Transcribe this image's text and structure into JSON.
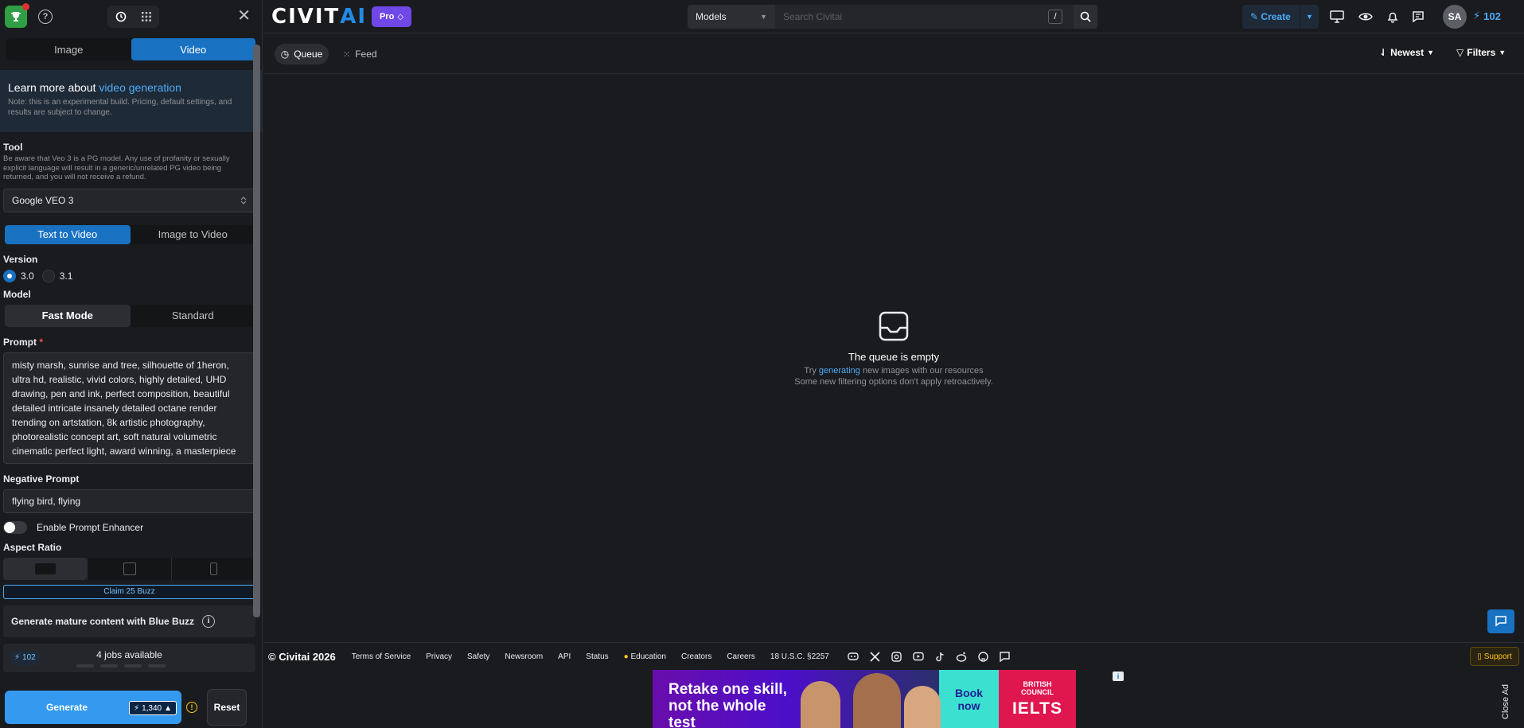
{
  "left_panel": {
    "tabs": [
      "Image",
      "Video"
    ],
    "learn_more": {
      "prefix": "Learn more about ",
      "link": "video generation",
      "note": "Note: this is an experimental build. Pricing, default settings, and results are subject to change."
    },
    "tool": {
      "label": "Tool",
      "warning": "Be aware that Veo 3 is a PG model. Any use of profanity or sexually explicit language will result in a generic/unrelated PG video being returned, and you will not receive a refund.",
      "selected": "Google VEO 3"
    },
    "mode_tabs": [
      "Text to Video",
      "Image to Video"
    ],
    "version": {
      "label": "Version",
      "options": [
        "3.0",
        "3.1"
      ],
      "selected": "3.0"
    },
    "model": {
      "label": "Model",
      "options": [
        "Fast Mode",
        "Standard"
      ],
      "selected": "Fast Mode"
    },
    "prompt": {
      "label": "Prompt",
      "required_mark": "*",
      "value": "misty marsh, sunrise and tree, silhouette of 1heron, ultra hd, realistic, vivid colors, highly detailed, UHD drawing, pen and ink, perfect composition, beautiful detailed intricate insanely detailed octane render trending on artstation, 8k artistic photography, photorealistic concept art, soft natural volumetric cinematic perfect light, award winning, a masterpiece"
    },
    "negative_prompt": {
      "label": "Negative Prompt",
      "value": "flying bird, flying"
    },
    "prompt_enhancer": {
      "label": "Enable Prompt Enhancer",
      "enabled": false
    },
    "aspect_ratio": {
      "label": "Aspect Ratio",
      "selected_index": 0
    },
    "claim_label": "Claim 25 Buzz",
    "mature_label": "Generate mature content with Blue Buzz",
    "jobs": {
      "buzz": "102",
      "text": "4 jobs available"
    },
    "generate_label": "Generate",
    "generate_cost": "1,340",
    "reset_label": "Reset"
  },
  "header": {
    "logo_a": "CIVIT",
    "logo_b": "AI",
    "pro_label": "Pro",
    "search_category": "Models",
    "search_placeholder": "Search Civitai",
    "search_shortcut": "/",
    "create_label": "Create",
    "avatar_initials": "SA",
    "buzz": "102"
  },
  "subbar": {
    "queue_label": "Queue",
    "feed_label": "Feed",
    "sort_label": "Newest",
    "filters_label": "Filters"
  },
  "empty_state": {
    "title": "The queue is empty",
    "line1_pre": "Try ",
    "line1_link": "generating",
    "line1_post": " new images with our resources",
    "line2": "Some new filtering options don't apply retroactively."
  },
  "footer": {
    "copyright": "© Civitai 2026",
    "links": [
      "Terms of Service",
      "Privacy",
      "Safety",
      "Newsroom",
      "API",
      "Status",
      "Education",
      "Creators",
      "Careers",
      "18 U.S.C. §2257"
    ],
    "support_label": "Support"
  },
  "ad": {
    "headline_1": "Retake one skill,",
    "headline_2": "not the whole test",
    "cta_1": "Book",
    "cta_2": "now",
    "brand_1": "BRITISH",
    "brand_2": "COUNCIL",
    "brand_3": "IELTS",
    "close_label": "Close Ad"
  },
  "colors": {
    "accent": "#1971c2",
    "background": "#1a1b1e",
    "link": "#4dabf7",
    "pro": "#7048e8"
  }
}
